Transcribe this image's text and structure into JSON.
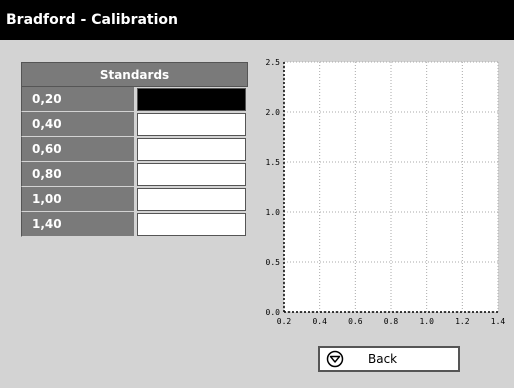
{
  "title": "Bradford - Calibration",
  "standards": {
    "header": "Standards",
    "rows": [
      {
        "label": "0,20",
        "selected": true
      },
      {
        "label": "0,40",
        "selected": false
      },
      {
        "label": "0,60",
        "selected": false
      },
      {
        "label": "0,80",
        "selected": false
      },
      {
        "label": "1,00",
        "selected": false
      },
      {
        "label": "1,40",
        "selected": false
      }
    ]
  },
  "chart_data": {
    "type": "scatter",
    "title": "",
    "xlabel": "",
    "ylabel": "",
    "xlim": [
      0.2,
      1.4
    ],
    "ylim": [
      0.0,
      2.5
    ],
    "x_ticks": [
      "0.2",
      "0.4",
      "0.6",
      "0.8",
      "1.0",
      "1.2",
      "1.4"
    ],
    "y_ticks": [
      "0.0",
      "0.5",
      "1.0",
      "1.5",
      "2.0",
      "2.5"
    ],
    "grid": true,
    "series": []
  },
  "back_button": {
    "label": "Back",
    "icon": "circle-down-arrow-icon"
  }
}
